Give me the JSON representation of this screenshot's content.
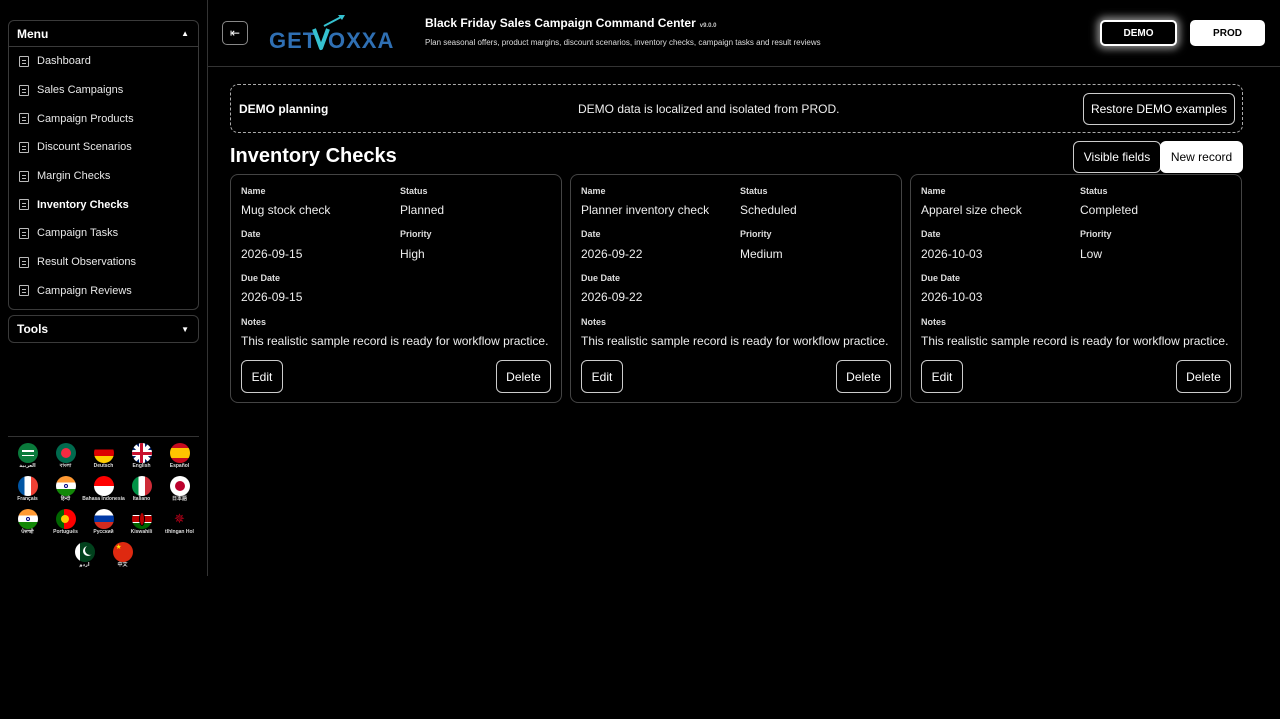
{
  "sidebar": {
    "menu_title": "Menu",
    "items": [
      {
        "label": "Dashboard"
      },
      {
        "label": "Sales Campaigns"
      },
      {
        "label": "Campaign Products"
      },
      {
        "label": "Discount Scenarios"
      },
      {
        "label": "Margin Checks"
      },
      {
        "label": "Inventory Checks",
        "active": true
      },
      {
        "label": "Campaign Tasks"
      },
      {
        "label": "Result Observations"
      },
      {
        "label": "Campaign Reviews"
      }
    ],
    "tools_title": "Tools",
    "languages": [
      {
        "label": "العربية"
      },
      {
        "label": "বাংলা"
      },
      {
        "label": "Deutsch"
      },
      {
        "label": "English"
      },
      {
        "label": "Español"
      },
      {
        "label": "Français"
      },
      {
        "label": "हिन्दी"
      },
      {
        "label": "Bahasa Indonesia"
      },
      {
        "label": "Italiano"
      },
      {
        "label": "日本語"
      },
      {
        "label": "ਪੰਜਾਬੀ"
      },
      {
        "label": "Português"
      },
      {
        "label": "Русский"
      },
      {
        "label": "Kiswahili"
      },
      {
        "label": "tlhIngan Hol"
      },
      {
        "label": "اردو"
      },
      {
        "label": "中文"
      }
    ]
  },
  "header": {
    "logo_text": "GETVOXXA",
    "title": "Black Friday Sales Campaign Command Center",
    "version": "v9.0.0",
    "subtitle": "Plan seasonal offers, product margins, discount scenarios, inventory checks, campaign tasks and result reviews",
    "demo_label": "DEMO",
    "prod_label": "PROD"
  },
  "banner": {
    "title": "DEMO planning",
    "message": "DEMO data is localized and isolated from PROD.",
    "restore_label": "Restore DEMO examples"
  },
  "main": {
    "title": "Inventory Checks",
    "visible_fields_label": "Visible fields",
    "new_record_label": "New record"
  },
  "field_labels": {
    "name": "Name",
    "status": "Status",
    "date": "Date",
    "priority": "Priority",
    "due_date": "Due Date",
    "notes": "Notes",
    "edit": "Edit",
    "delete": "Delete"
  },
  "records": [
    {
      "name": "Mug stock check",
      "status": "Planned",
      "date": "2026-09-15",
      "priority": "High",
      "due_date": "2026-09-15",
      "notes": "This realistic sample record is ready for workflow practice."
    },
    {
      "name": "Planner inventory check",
      "status": "Scheduled",
      "date": "2026-09-22",
      "priority": "Medium",
      "due_date": "2026-09-22",
      "notes": "This realistic sample record is ready for workflow practice."
    },
    {
      "name": "Apparel size check",
      "status": "Completed",
      "date": "2026-10-03",
      "priority": "Low",
      "due_date": "2026-10-03",
      "notes": "This realistic sample record is ready for workflow practice."
    }
  ],
  "colors": {
    "background": "#000000",
    "logo_blue": "#2f6fb3",
    "logo_teal": "#35c1d0"
  }
}
